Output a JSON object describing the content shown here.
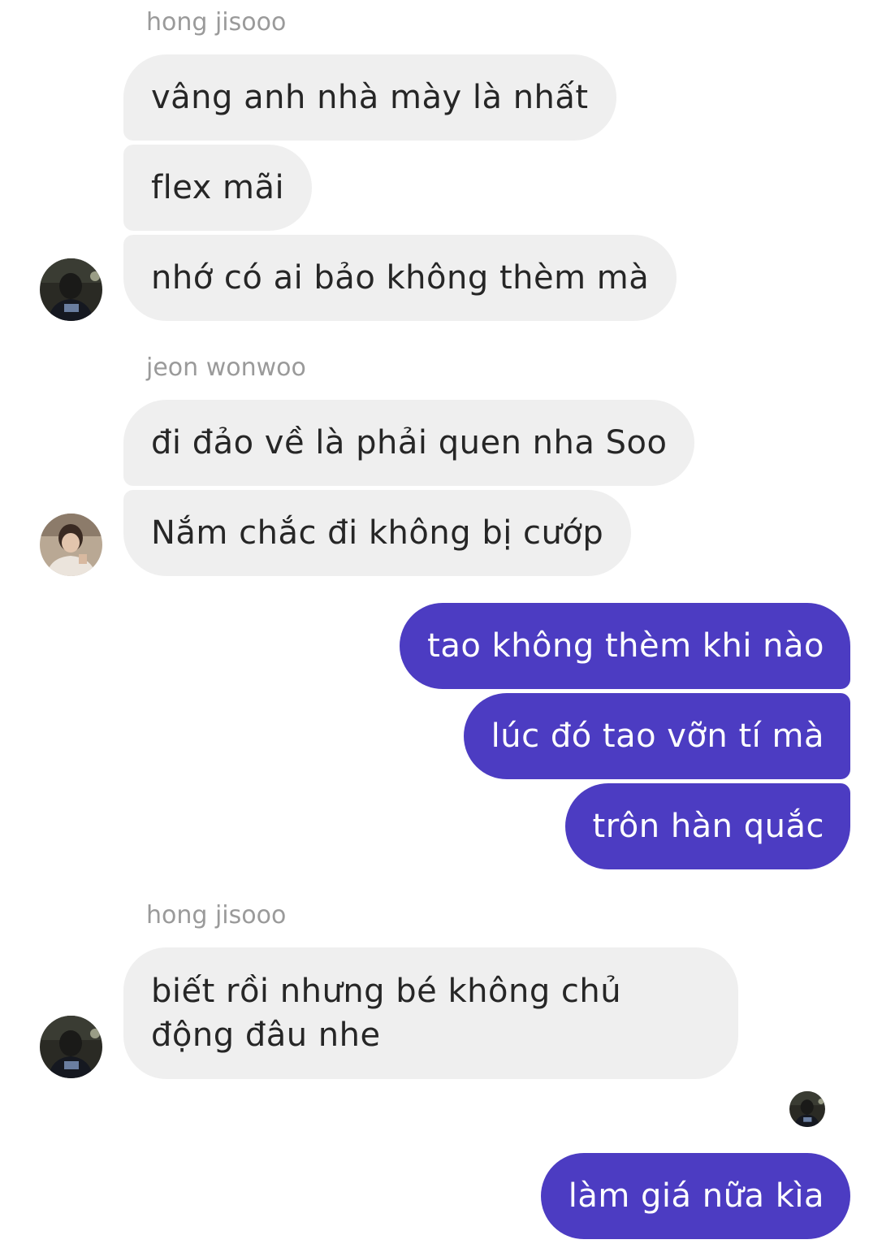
{
  "messages": {
    "group1": {
      "sender": "hong jisooo",
      "bubbles": [
        "vâng anh nhà mày là nhất",
        "flex mãi",
        "nhớ có ai bảo không thèm mà"
      ]
    },
    "group2": {
      "sender": "jeon wonwoo",
      "bubbles": [
        "đi đảo về là phải quen nha Soo",
        "Nắm chắc đi không bị cướp"
      ]
    },
    "group3": {
      "bubbles": [
        "tao không thèm khi nào",
        "lúc đó tao vỡn tí mà",
        "trôn hàn quắc"
      ]
    },
    "group4": {
      "sender": "hong jisooo",
      "bubbles": [
        "biết rồi nhưng bé không chủ động đâu nhe"
      ]
    },
    "group5": {
      "bubbles": [
        "làm giá nữa kìa"
      ]
    }
  },
  "colors": {
    "incoming_bubble": "#efefef",
    "outgoing_bubble": "#4c3cc2",
    "sender_name": "#9a9a9a"
  },
  "icons": {
    "avatar_jisoo": "avatar-jisoo-icon",
    "avatar_wonwoo": "avatar-wonwoo-icon",
    "read_receipt": "read-receipt-avatar-icon"
  }
}
